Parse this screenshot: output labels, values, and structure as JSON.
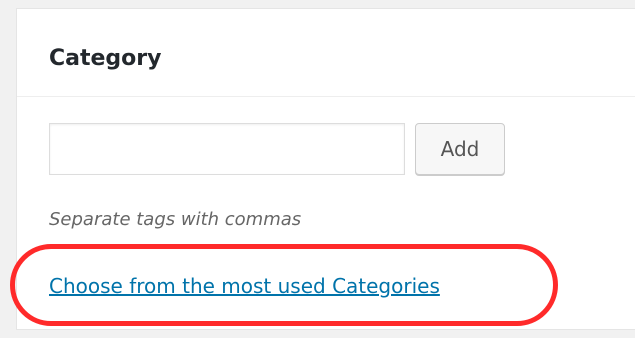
{
  "panel": {
    "title": "Category",
    "input": {
      "value": "",
      "placeholder": ""
    },
    "add_button_label": "Add",
    "hint": "Separate tags with commas",
    "most_used_link": "Choose from the most used Categories"
  },
  "colors": {
    "link": "#0073aa",
    "highlight": "#ff2a2a"
  }
}
